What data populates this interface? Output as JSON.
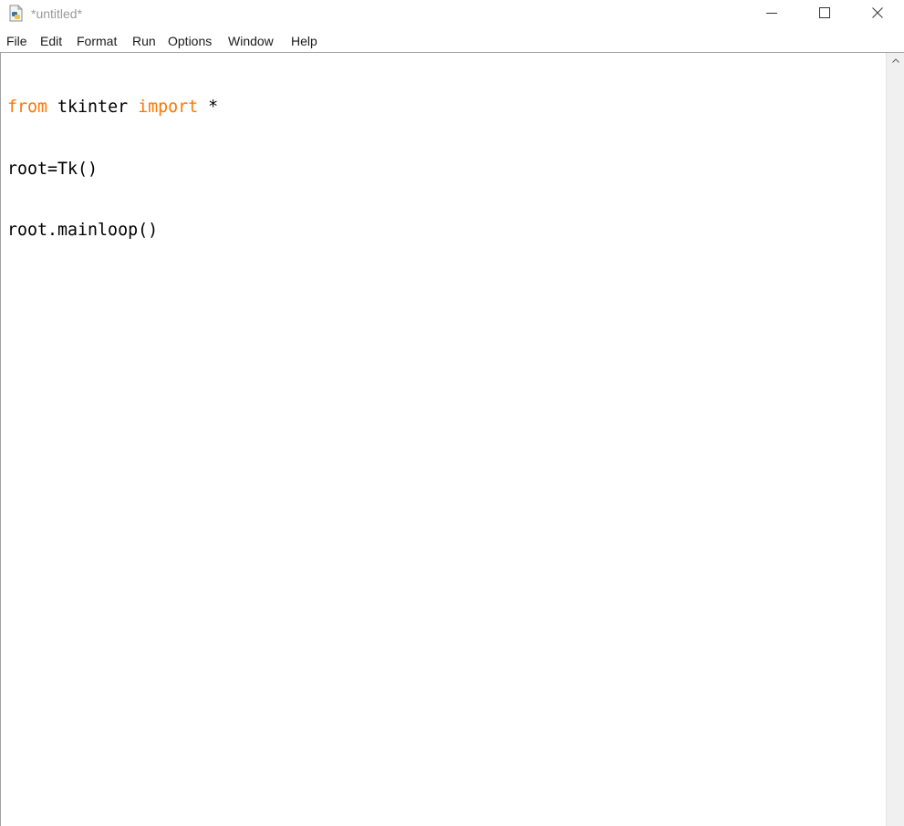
{
  "window": {
    "title": "*untitled*"
  },
  "menu": {
    "items": [
      "File",
      "Edit",
      "Format",
      "Run",
      "Options",
      "Window",
      "Help"
    ]
  },
  "editor": {
    "lines": [
      [
        {
          "text": "from",
          "kind": "keyword"
        },
        {
          "text": " tkinter ",
          "kind": "plain"
        },
        {
          "text": "import",
          "kind": "keyword"
        },
        {
          "text": " *",
          "kind": "plain"
        }
      ],
      [
        {
          "text": "root=Tk()",
          "kind": "plain"
        }
      ],
      [
        {
          "text": "root.mainloop()",
          "kind": "plain"
        }
      ]
    ]
  },
  "colors": {
    "keyword": "#ff7700",
    "text": "#000000",
    "title_text": "#9a9a9a"
  },
  "icons": {
    "app": "python-file-icon",
    "minimize": "minimize-icon",
    "maximize": "maximize-icon",
    "close": "close-icon",
    "scroll_up": "chevron-up-icon"
  }
}
